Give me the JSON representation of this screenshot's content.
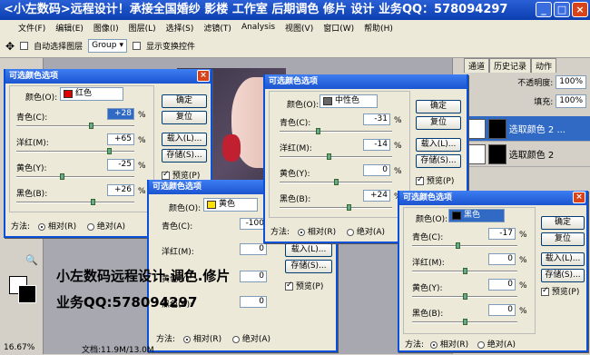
{
  "title": "<小左数码>远程设计！承接全国婚纱 影楼 工作室 后期调色 修片 设计 业务QQ：578094297",
  "window_buttons": [
    "_",
    "□",
    "×"
  ],
  "menu": [
    "文件(F)",
    "编辑(E)",
    "图像(I)",
    "图层(L)",
    "选择(S)",
    "滤镜(T)",
    "Analysis",
    "视图(V)",
    "窗口(W)",
    "帮助(H)"
  ],
  "options": {
    "auto_select": "自动选择图层",
    "group_value": "Group",
    "show_transform": "显示变换控件"
  },
  "panel": {
    "tabs": [
      "通道",
      "历史记录",
      "动作"
    ],
    "opacity_label": "不透明度:",
    "opacity_value": "100%",
    "fill_label": "填充:",
    "fill_value": "100%",
    "layers": [
      {
        "name": "选取颜色 2 ..."
      },
      {
        "name": "选取颜色 2"
      },
      {
        "name": ""
      }
    ]
  },
  "dialogs": {
    "common": {
      "title": "可选颜色选项",
      "color_label": "颜色(O):",
      "ok": "确定",
      "reset": "复位",
      "load": "载入(L)...",
      "save": "存储(S)...",
      "preview": "预览(P)",
      "method": "方法:",
      "relative": "相对(R)",
      "absolute": "绝对(A)",
      "cyan": "青色(C):",
      "magenta": "洋红(M):",
      "yellow": "黄色(Y):",
      "black": "黑色(B):",
      "pct": "%"
    },
    "d1": {
      "color": "红色",
      "swatch": "#e00000",
      "cyan": "+28",
      "magenta": "+65",
      "yellow": "-25",
      "black": "+26"
    },
    "d2": {
      "color": "中性色",
      "swatch": "#666666",
      "cyan": "-31",
      "magenta": "-14",
      "yellow": "0",
      "black": "+24"
    },
    "d3": {
      "color": "黄色",
      "swatch": "#ffe000",
      "cyan": "-100",
      "magenta": "0",
      "yellow": "0",
      "black": "0"
    },
    "d4": {
      "color": "黑色",
      "swatch": "#000000",
      "cyan": "-17",
      "magenta": "0",
      "yellow": "0",
      "black": "0"
    }
  },
  "watermark": {
    "line1": "小左数码远程设计.调色.修片",
    "line2": "业务QQ:578094297"
  },
  "status": {
    "zoom": "16.67%",
    "doc": "文档:11.9M/13.0M"
  }
}
